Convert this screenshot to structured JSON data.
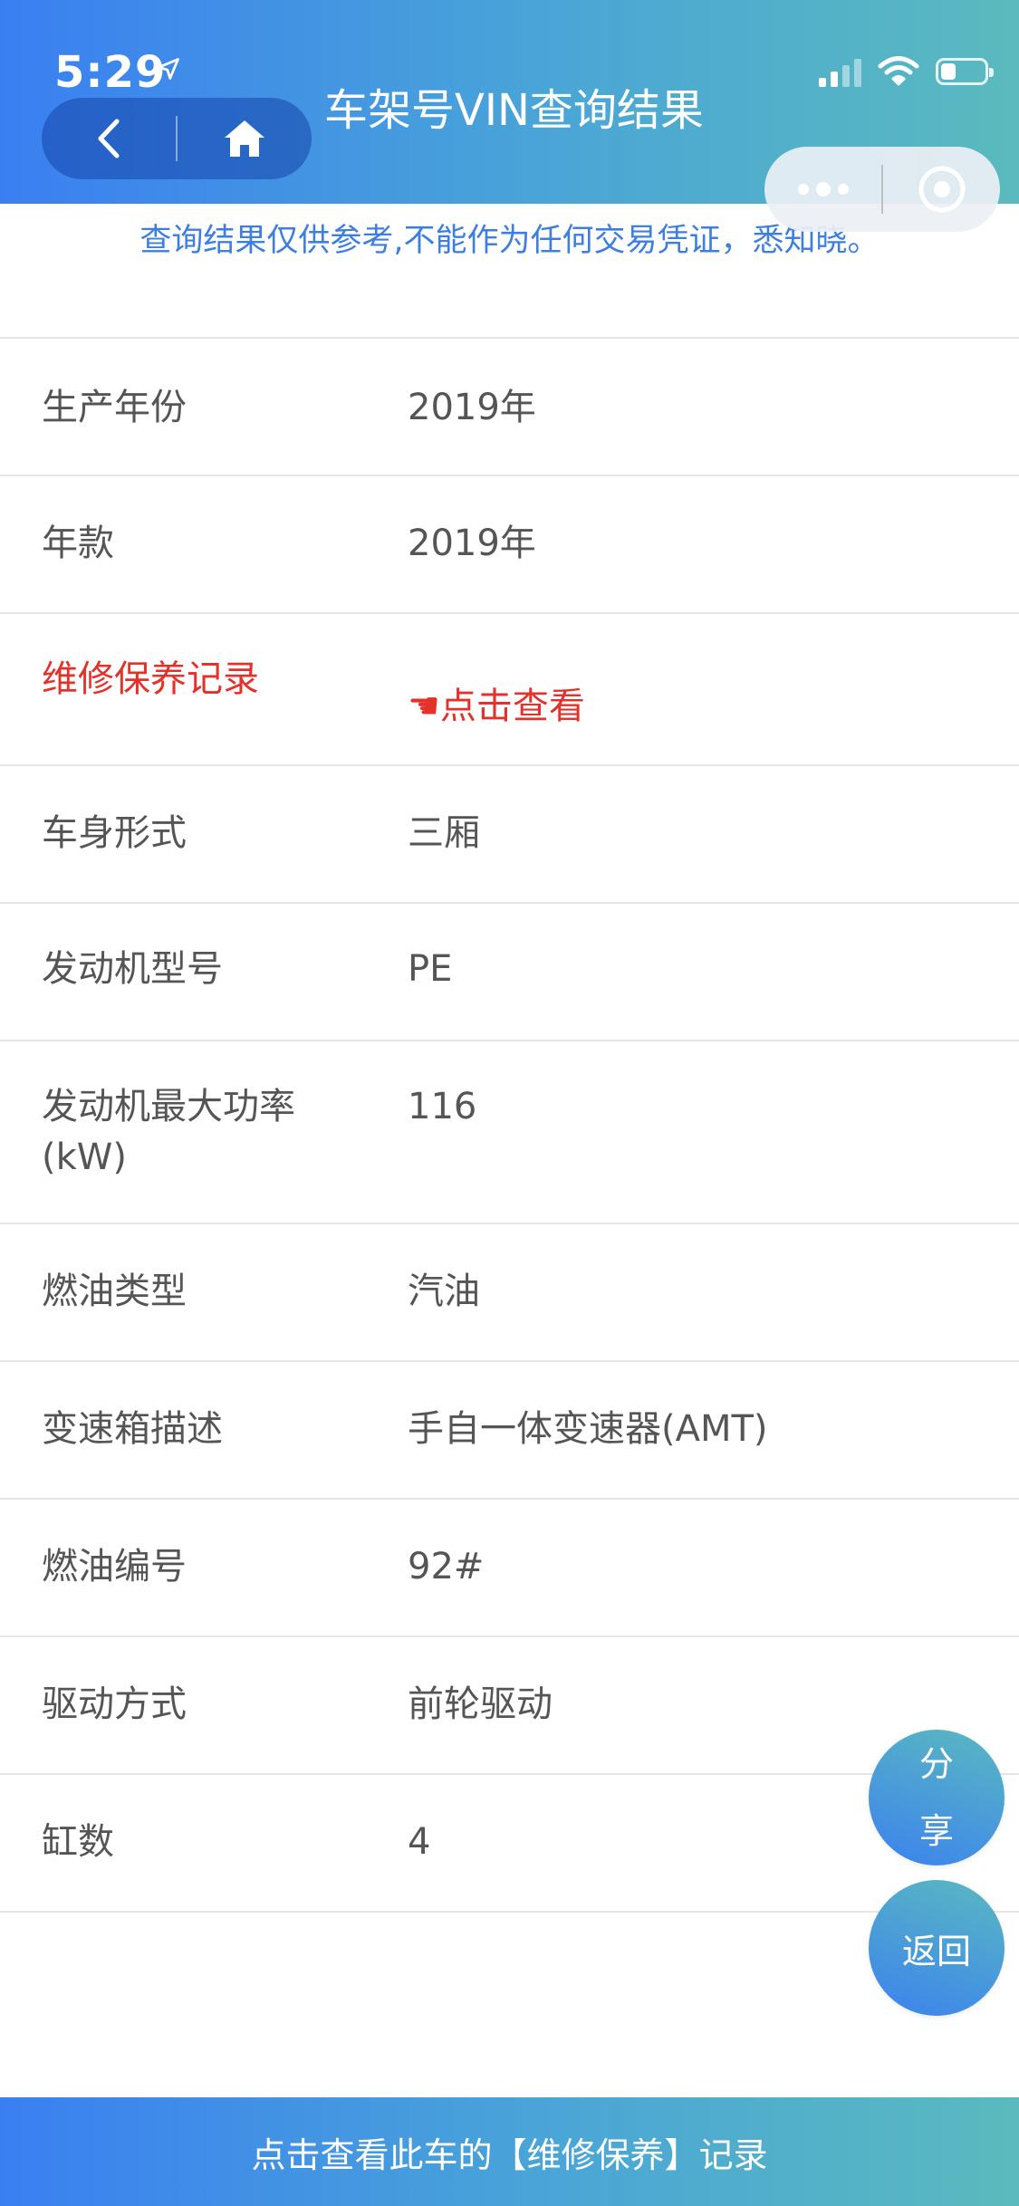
{
  "status_bar": {
    "time": "5:29"
  },
  "header": {
    "title": "车架号VIN查询结果"
  },
  "notice": "查询结果仅供参考,不能作为任何交易凭证，悉知晓。",
  "rows": [
    {
      "label": "",
      "value": ""
    },
    {
      "label": "生产年份",
      "value": "2019年"
    },
    {
      "label": "年款",
      "value": "2019年"
    },
    {
      "label": "维修保养记录",
      "value": "☚点击查看"
    },
    {
      "label": "车身形式",
      "value": "三厢"
    },
    {
      "label": "发动机型号",
      "value": "PE"
    },
    {
      "label": "发动机最大功率(kW)",
      "value": "116"
    },
    {
      "label": "燃油类型",
      "value": "汽油"
    },
    {
      "label": "变速箱描述",
      "value": "手自一体变速器(AMT)"
    },
    {
      "label": "燃油编号",
      "value": "92#"
    },
    {
      "label": "驱动方式",
      "value": "前轮驱动"
    },
    {
      "label": "缸数",
      "value": "4"
    }
  ],
  "floating": {
    "share_line1": "分",
    "share_line2": "享",
    "back": "返回"
  },
  "bottom_bar": {
    "label": "点击查看此车的【维修保养】记录"
  },
  "colors": {
    "accent_blue": "#3A7FF2",
    "accent_teal": "#5ABABE",
    "highlight_red": "#E4312A",
    "notice_blue": "#3D7FE0"
  },
  "icons": {
    "location": "location-arrow-icon",
    "back": "chevron-left-icon",
    "home": "home-icon",
    "more": "more-dots-icon",
    "target": "target-icon",
    "signal": "signal-icon",
    "wifi": "wifi-icon",
    "battery": "battery-icon",
    "pointer": "hand-pointing-icon"
  }
}
